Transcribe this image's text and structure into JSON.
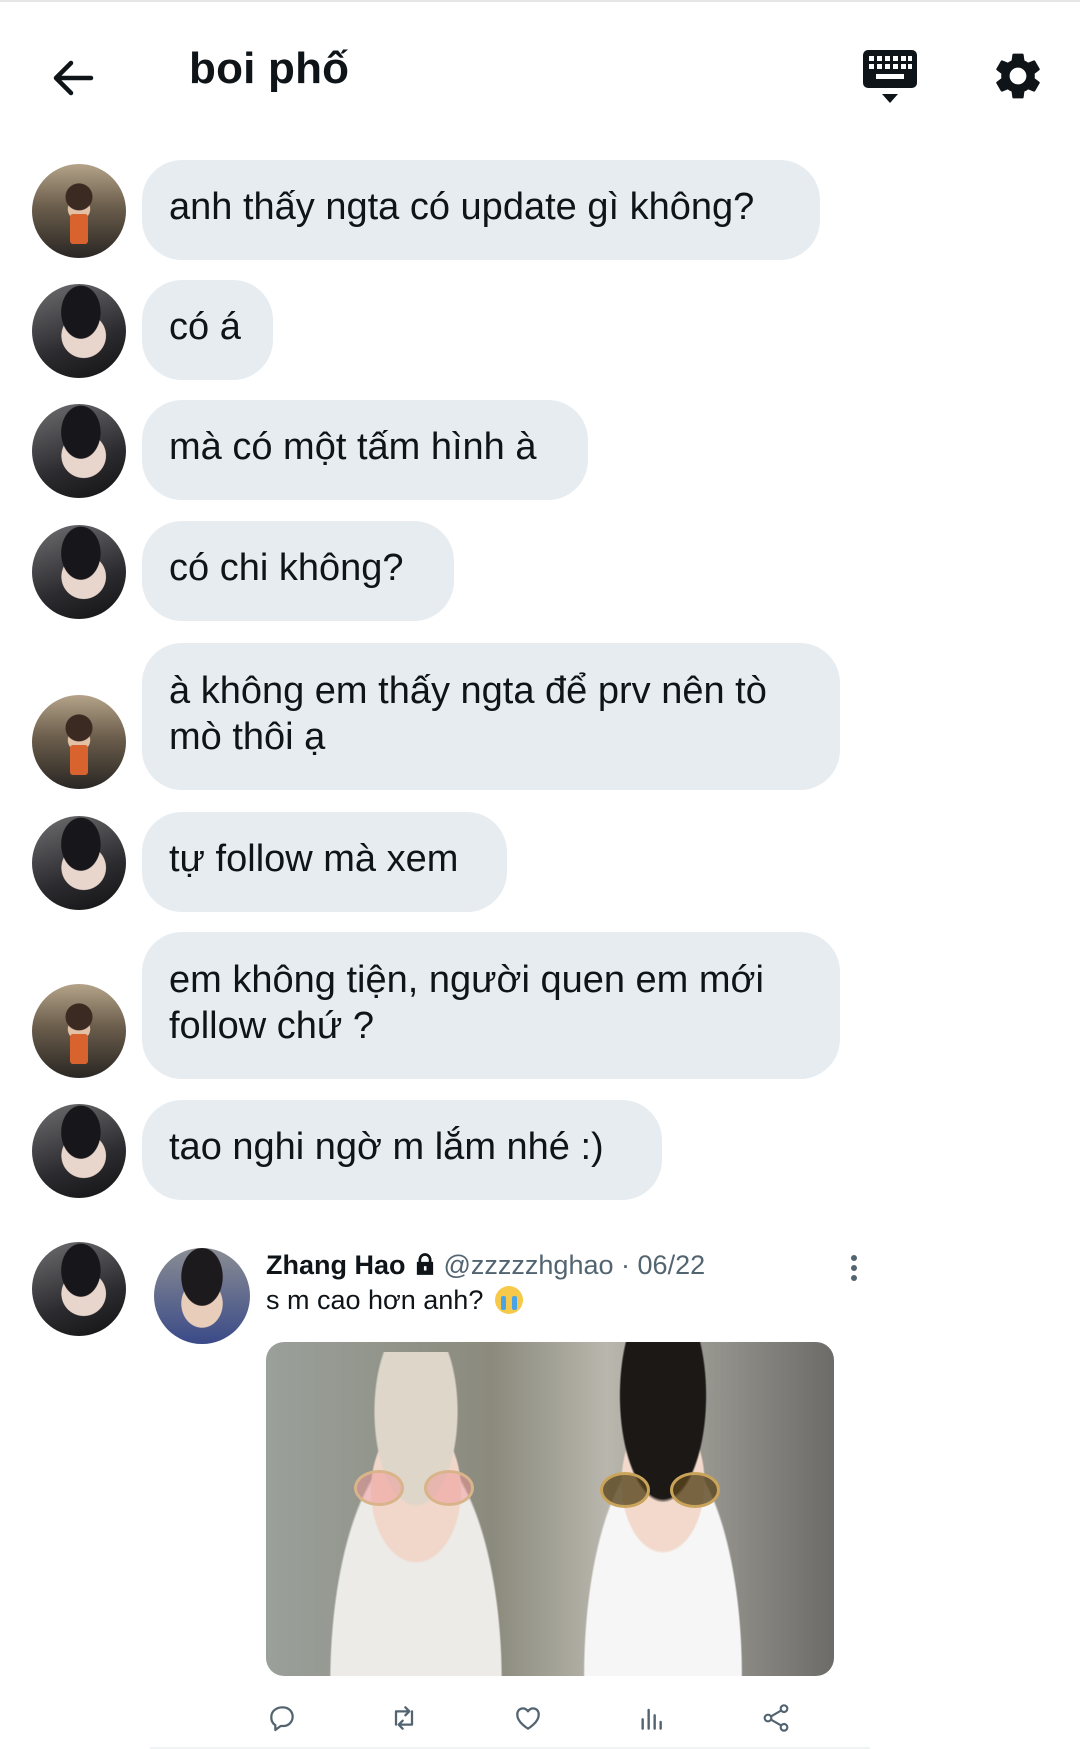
{
  "header": {
    "title": "boi phố",
    "back_icon": "arrow-left-icon",
    "keyboard_icon": "keyboard-icon",
    "settings_icon": "gear-icon"
  },
  "messages": [
    {
      "sender": "a",
      "text": "anh thấy ngta có update gì không?"
    },
    {
      "sender": "b",
      "text": "có á"
    },
    {
      "sender": "b",
      "text": "mà có một tấm hình à"
    },
    {
      "sender": "b",
      "text": "có chi không?"
    },
    {
      "sender": "a",
      "text": "à không em thấy ngta để prv nên tò mò thôi ạ"
    },
    {
      "sender": "b",
      "text": "tự follow mà xem"
    },
    {
      "sender": "a",
      "text": "em không tiện, người quen em mới follow chứ ?"
    },
    {
      "sender": "b",
      "text": "tao nghi ngờ m lắm nhé :)"
    }
  ],
  "shared_tweet": {
    "name": "Zhang Hao",
    "handle": "@zzzzzhghao",
    "separator": "·",
    "date": "06/22",
    "text": "s m cao hơn anh?",
    "emoji": "loudly-crying-face-emoji",
    "actions": [
      "reply-icon",
      "retweet-icon",
      "like-icon",
      "analytics-icon",
      "share-icon"
    ]
  },
  "colors": {
    "bubble": "#e7ecf0",
    "text": "#0f1419",
    "secondary": "#536471",
    "background": "#ffffff"
  }
}
